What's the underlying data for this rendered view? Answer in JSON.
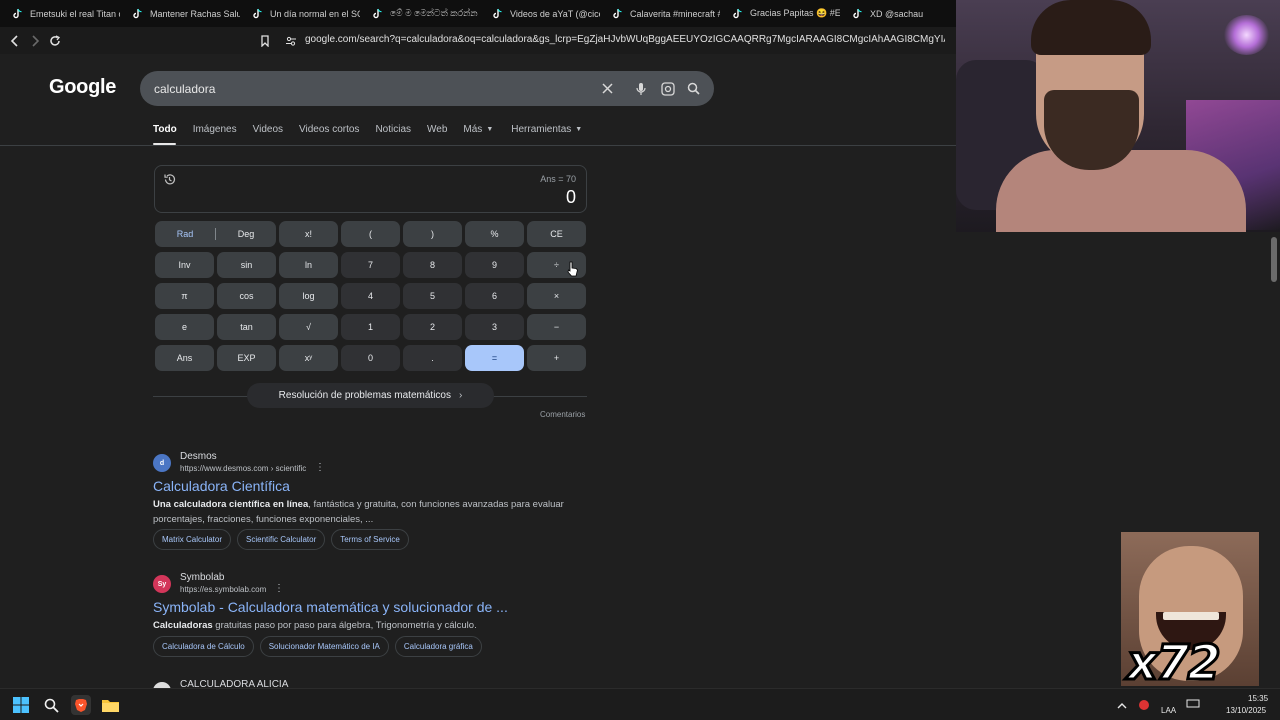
{
  "browser": {
    "tabs": [
      {
        "title": "Emetsuki el real Titan carg"
      },
      {
        "title": "Mantener Rachas Saludab"
      },
      {
        "title": "Un día normal en el SOFA"
      },
      {
        "title": "මේ ම මෙන්ටත් කරන්න"
      },
      {
        "title": "Videos de aYaT (@cicem.u"
      },
      {
        "title": "Calaverita #minecraft #Ar"
      },
      {
        "title": "Gracias Papitas 😆 #Emet"
      },
      {
        "title": "XD @sachau"
      }
    ],
    "url": "google.com/search?q=calculadora&oq=calculadora&gs_lcrp=EgZjaHJvbWUqBggAEEUYOzIGCAAQRRg7MgcIARAAGI8CMgcIAhAAGI8CMgYIAxAuGEDSA..."
  },
  "google": {
    "logo": "Google",
    "query": "calculadora",
    "tabs": [
      {
        "label": "Todo",
        "active": true
      },
      {
        "label": "Imágenes"
      },
      {
        "label": "Videos"
      },
      {
        "label": "Videos cortos"
      },
      {
        "label": "Noticias"
      },
      {
        "label": "Web"
      },
      {
        "label": "Más",
        "dropdown": true
      },
      {
        "label": "Herramientas",
        "dropdown": true
      }
    ]
  },
  "calculator": {
    "ans": "Ans = 70",
    "display": "0",
    "rad": "Rad",
    "deg": "Deg",
    "keys": [
      [
        "x!",
        "(",
        ")",
        "%",
        "CE"
      ],
      [
        "Inv",
        "sin",
        "ln",
        "7",
        "8",
        "9",
        "÷"
      ],
      [
        "π",
        "cos",
        "log",
        "4",
        "5",
        "6",
        "×"
      ],
      [
        "e",
        "tan",
        "√",
        "1",
        "2",
        "3",
        "−"
      ],
      [
        "Ans",
        "EXP",
        "xʸ",
        "0",
        ".",
        "=",
        "+"
      ]
    ],
    "math_help": "Resolución de problemas matemáticos",
    "feedback": "Comentarios"
  },
  "results": [
    {
      "site": "Desmos",
      "url": "https://www.desmos.com › scientific",
      "title": "Calculadora Científica",
      "snippet_bold": "Una calculadora científica en línea",
      "snippet": ", fantástica y gratuita, con funciones avanzadas para evaluar porcentajes, fracciones, funciones exponenciales, ...",
      "chips": [
        "Matrix Calculator",
        "Scientific Calculator",
        "Terms of Service"
      ],
      "favicon": "d",
      "favicon_color": "#4b76c4"
    },
    {
      "site": "Symbolab",
      "url": "https://es.symbolab.com",
      "title": "Symbolab - Calculadora matemática y solucionador de ...",
      "snippet_bold": "Calculadoras",
      "snippet": " gratuitas paso por paso para álgebra, Trigonometría y cálculo.",
      "chips": [
        "Calculadora de Cálculo",
        "Solucionador Matemático de IA",
        "Calculadora gráfica"
      ],
      "favicon": "Sy",
      "favicon_color": "#d3365a"
    },
    {
      "site": "CALCULADORA ALICIA"
    }
  ],
  "overlay": {
    "meme_text": "x72"
  },
  "taskbar": {
    "lang": "LAA",
    "time": "15:35",
    "date": "13/10/2025"
  },
  "colors": {
    "link": "#8ab4f8",
    "equals_key": "#a8c7fa",
    "background": "#1f1f1f"
  }
}
